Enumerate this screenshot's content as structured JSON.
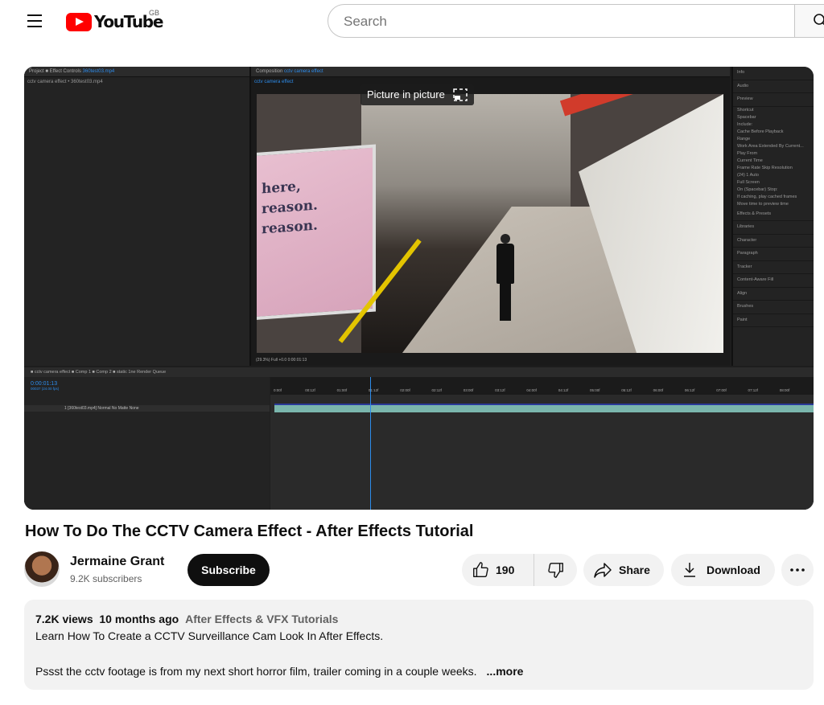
{
  "header": {
    "logo_text": "YouTube",
    "country_code": "GB",
    "search_placeholder": "Search"
  },
  "player": {
    "pip_label": "Picture in picture",
    "ae": {
      "left_tabs": "Project   ■ Effect Controls",
      "left_tab_file": "360test03.mp4",
      "left_sub": "cctv camera effect • 360test03.mp4",
      "comp_tab": "Composition",
      "comp_name": "cctv camera effect",
      "comp_sub": "cctv camera effect",
      "ad_text": [
        "here,",
        "reason.",
        "reason."
      ],
      "viewer_foot": "(29.3%)   Full          +0.0        0:00:01:13",
      "right_panels": [
        "Info",
        "Audio",
        "Preview",
        "Shortcut",
        "Spacebar",
        "Include:",
        "Cache Before Playback",
        "Range",
        "Work Area Extended By Current...",
        "Play From",
        "Current Time",
        "Frame Rate  Skip  Resolution",
        "(24)   1   Auto",
        "Full Screen",
        "On (Spacebar) Stop:",
        "If caching, play cached frames",
        "Move time to preview time",
        "Effects & Presets",
        "Libraries",
        "Character",
        "Paragraph",
        "Tracker",
        "Content-Aware Fill",
        "Align",
        "Brushes",
        "Paint"
      ],
      "timeline_tabs": "■ cctv camera effect   ■ Comp 1   ■ Comp 2   ■ static 1ne   Render Queue",
      "timecode": "0:00:01:13",
      "fps": "00037 (24.00 fps)",
      "layer_row": "1   [360test03.mp4]   Normal   No Matte   None",
      "ruler_ticks": [
        "0:00f",
        "00:12f",
        "01:00f",
        "01:12f",
        "02:00f",
        "02:12f",
        "03:00f",
        "03:12f",
        "04:00f",
        "04:12f",
        "05:00f",
        "05:12f",
        "06:00f",
        "06:12f",
        "07:00f",
        "07:12f",
        "08:00f"
      ]
    }
  },
  "video": {
    "title": "How To Do The CCTV Camera Effect - After Effects Tutorial"
  },
  "channel": {
    "name": "Jermaine Grant",
    "subscribers": "9.2K subscribers",
    "subscribe_label": "Subscribe"
  },
  "actions": {
    "likes": "190",
    "share_label": "Share",
    "download_label": "Download"
  },
  "description": {
    "views": "7.2K views",
    "date": "10 months ago",
    "tag": "After Effects & VFX Tutorials",
    "line1": "Learn How To Create a CCTV Surveillance Cam Look In After Effects.",
    "line2": "Pssst the cctv footage is from my next short horror film, trailer coming in a couple weeks.",
    "more_label": "...more"
  }
}
